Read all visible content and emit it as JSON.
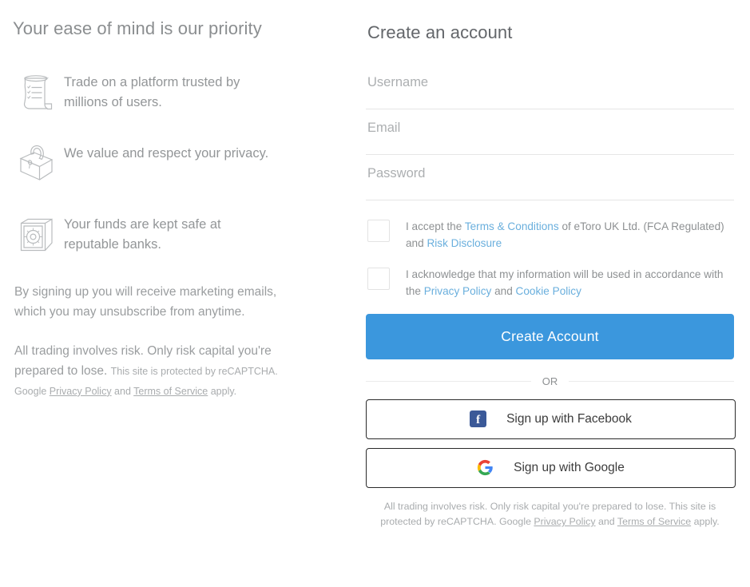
{
  "left": {
    "heading": "Your ease of mind is our priority",
    "benefits": [
      {
        "icon": "scroll-document-icon",
        "text": "Trade on a platform trusted by millions of users."
      },
      {
        "icon": "padlock-icon",
        "text": "We value and respect your privacy."
      },
      {
        "icon": "safe-vault-icon",
        "text": "Your funds are kept safe at reputable banks."
      }
    ],
    "marketing_note": "By signing up you will receive marketing emails, which you may unsubscribe from anytime.",
    "risk_note": "All trading involves risk. Only risk capital you're prepared to lose.",
    "recaptcha_pre": "This site is protected by reCAPTCHA. Google ",
    "recaptcha_privacy": "Privacy Policy",
    "recaptcha_and": " and ",
    "recaptcha_terms": "Terms of Service",
    "recaptcha_post": " apply."
  },
  "form": {
    "title": "Create an account",
    "fields": [
      {
        "name": "username",
        "value": "",
        "placeholder": "Username"
      },
      {
        "name": "email",
        "value": "",
        "placeholder": "Email"
      },
      {
        "name": "password",
        "value": "",
        "placeholder": "Password"
      }
    ],
    "checkbox_terms": {
      "part1": "I accept the ",
      "link1": "Terms & Conditions",
      "part2": " of eToro UK Ltd. (FCA Regulated) and ",
      "link2": "Risk Disclosure",
      "checked": false
    },
    "checkbox_privacy": {
      "part1": "I acknowledge that my information will be used in accordance with the ",
      "link1": "Privacy Policy",
      "part2": " and ",
      "link2": "Cookie Policy",
      "checked": false
    },
    "submit_label": "Create Account",
    "or_label": "OR",
    "social": [
      {
        "icon": "facebook-icon",
        "label": "Sign up with Facebook"
      },
      {
        "icon": "google-icon",
        "label": "Sign up with Google"
      }
    ],
    "footnote_pre": "All trading involves risk. Only risk capital you're prepared to lose. This site is protected by reCAPTCHA. Google ",
    "footnote_privacy": "Privacy Policy",
    "footnote_and": " and ",
    "footnote_terms": "Terms of Service",
    "footnote_post": " apply."
  },
  "colors": {
    "accent": "#3b97dd",
    "link": "#6aafdd",
    "facebook": "#3b5998",
    "text_grey": "#8e9193"
  }
}
